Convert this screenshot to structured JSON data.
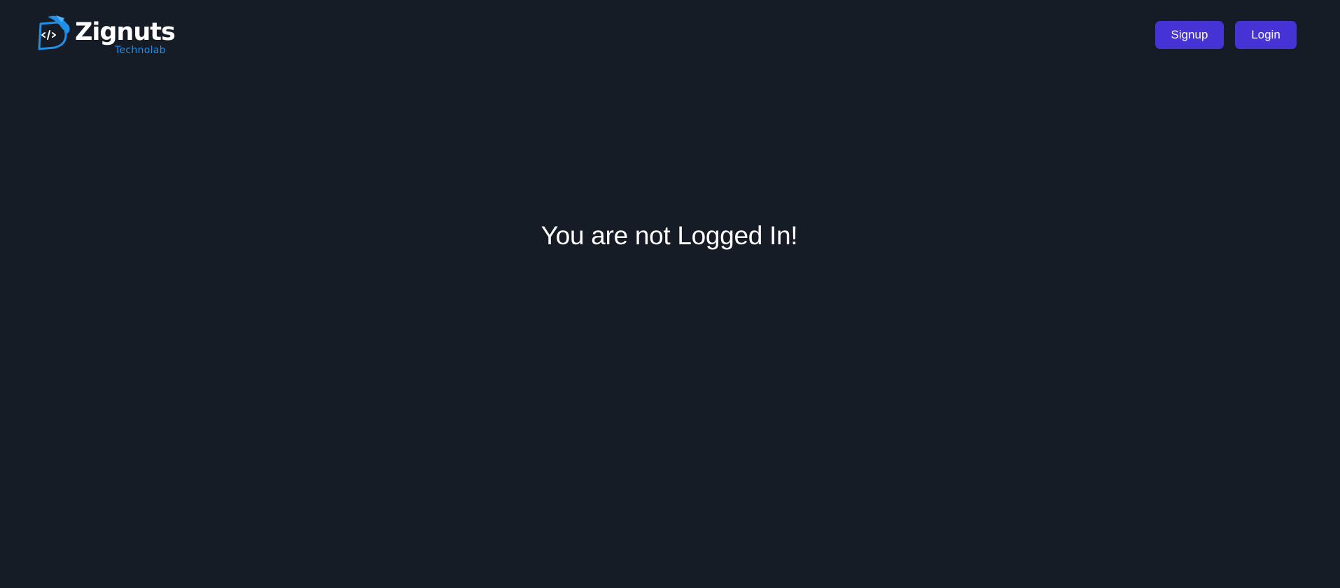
{
  "brand": {
    "name": "Zignuts",
    "subtitle": "Technolab",
    "logo_icon": "code-brackets-icon",
    "colors": {
      "primary": "#1f8fe8",
      "dark": "#0d62b8"
    }
  },
  "header": {
    "signup_label": "Signup",
    "login_label": "Login"
  },
  "main": {
    "message": "You are not Logged In!"
  },
  "colors": {
    "background": "#161c26",
    "button": "#4633d6",
    "text": "#ffffff"
  }
}
